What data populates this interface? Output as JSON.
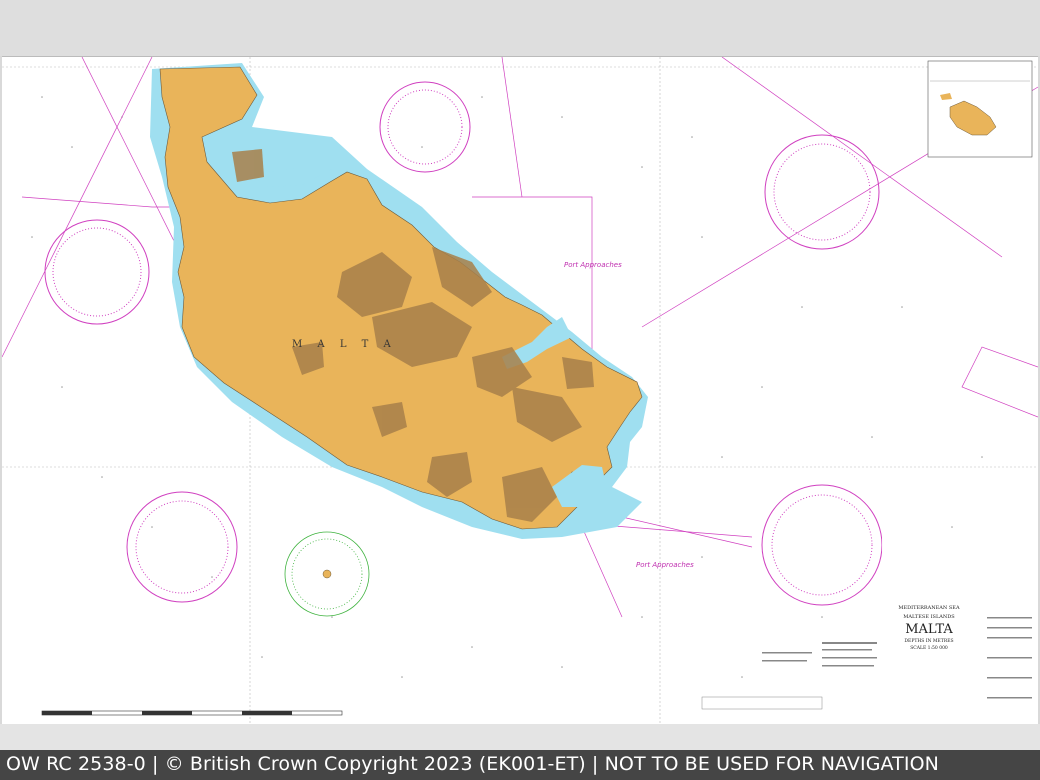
{
  "footer": {
    "text": "OW RC 2538-0 | © British Crown Copyright 2023 (EK001-ET) | NOT TO BE USED FOR NAVIGATION"
  },
  "chart": {
    "title_sea": "MEDITERRANEAN SEA",
    "title_group": "MALTESE ISLANDS",
    "title_main": "MALTA",
    "depths": "DEPTHS IN METRES",
    "scale": "SCALE 1:50 000",
    "island_label": "M A L T A",
    "port_approaches_1": "Port Approaches",
    "port_approaches_2": "Port Approaches"
  },
  "colors": {
    "land": "#e9b45a",
    "land_dark": "#a8804a",
    "shallow": "#9fdff0",
    "magenta": "#d040c0",
    "sea": "#ffffff"
  }
}
